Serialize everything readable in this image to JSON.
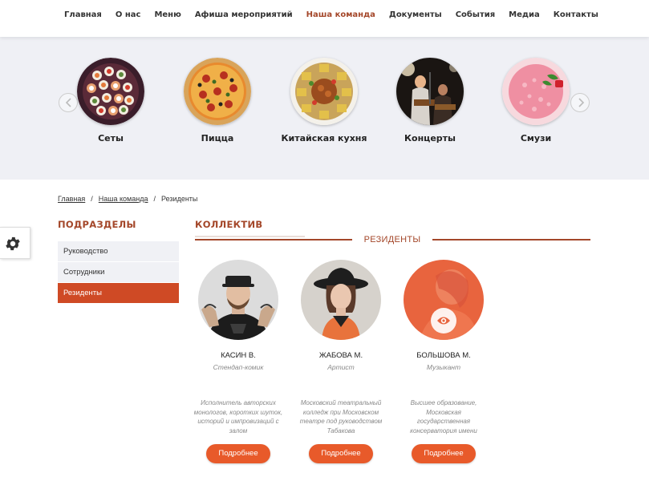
{
  "nav": {
    "items": [
      "Главная",
      "О нас",
      "Меню",
      "Афиша мероприятий",
      "Наша команда",
      "Документы",
      "События",
      "Медиа",
      "Контакты"
    ],
    "active_index": 4
  },
  "categories": [
    "Сеты",
    "Пицца",
    "Китайская кухня",
    "Концерты",
    "Смузи"
  ],
  "breadcrumb": {
    "items": [
      "Главная",
      "Наша команда",
      "Резиденты"
    ],
    "separator": "/"
  },
  "sidebar": {
    "title": "ПОДРАЗДЕЛЫ",
    "items": [
      "Руководство",
      "Сотрудники",
      "Резиденты"
    ],
    "active_index": 2
  },
  "main": {
    "title": "КОЛЛЕКТИВ",
    "section": "РЕЗИДЕНТЫ",
    "members": [
      {
        "name": "КАСИН В.",
        "role": "Стендап-комик",
        "description": "Исполнитель авторских монологов, коротких шуток, историй и импровизаций с залом",
        "button": "Подробнее"
      },
      {
        "name": "ЖАБОВА М.",
        "role": "Артист",
        "description": "Московский театральный колледж при Московском театре под руководством Табакова",
        "button": "Подробнее"
      },
      {
        "name": "БОЛЬШОВА М.",
        "role": "Музыкант",
        "description": "Высшее образование, Московская государственная консерватория имени",
        "button": "Подробнее"
      }
    ]
  },
  "icons": {
    "carousel_prev": "chevron-left-icon",
    "carousel_next": "chevron-right-icon",
    "settings": "gear-icon",
    "preview": "eye-icon"
  },
  "colors": {
    "accent": "#a4472a",
    "active_bg": "#cf4a25",
    "button_bg": "#e85a2a",
    "carousel_bg": "#eff0f5"
  }
}
